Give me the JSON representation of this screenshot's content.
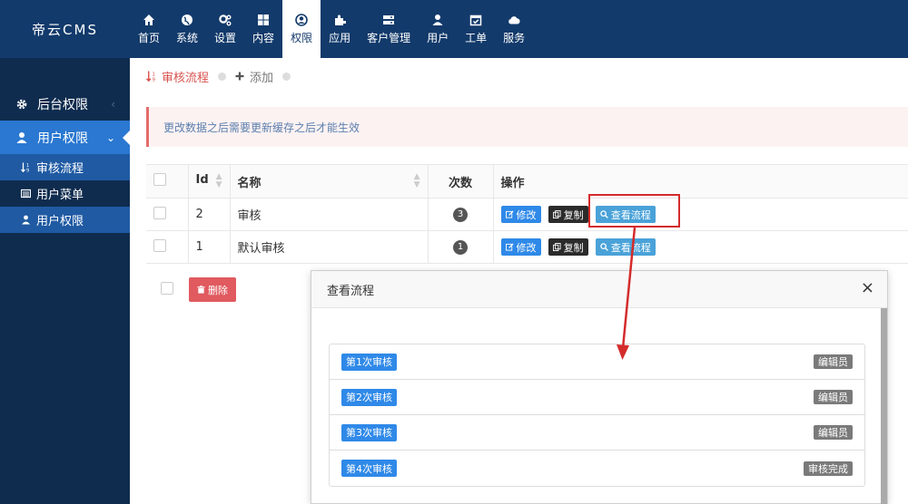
{
  "brand": "帝云CMS",
  "nav": [
    {
      "label": "首页",
      "icon": "home-icon"
    },
    {
      "label": "系统",
      "icon": "globe-icon"
    },
    {
      "label": "设置",
      "icon": "cogs-icon"
    },
    {
      "label": "内容",
      "icon": "grid-icon"
    },
    {
      "label": "权限",
      "icon": "user-circle-icon"
    },
    {
      "label": "应用",
      "icon": "puzzle-icon"
    },
    {
      "label": "客户管理",
      "icon": "server-icon"
    },
    {
      "label": "用户",
      "icon": "user-icon"
    },
    {
      "label": "工单",
      "icon": "calendar-check-icon"
    },
    {
      "label": "服务",
      "icon": "cloud-icon"
    }
  ],
  "sidebar": {
    "groups": [
      {
        "label": "后台权限",
        "icon": "gear-icon"
      },
      {
        "label": "用户权限",
        "icon": "user-icon"
      }
    ],
    "sub_items": [
      {
        "label": "审核流程",
        "icon": "sort-numeric-icon"
      },
      {
        "label": "用户菜单",
        "icon": "list-icon"
      },
      {
        "label": "用户权限",
        "icon": "user-icon"
      }
    ]
  },
  "breadcrumb": {
    "current": "审核流程",
    "add": "添加"
  },
  "alert": "更改数据之后需要更新缓存之后才能生效",
  "table": {
    "headers": {
      "id": "Id",
      "name": "名称",
      "count": "次数",
      "actions": "操作"
    },
    "rows": [
      {
        "id": "2",
        "name": "审核",
        "count": "3"
      },
      {
        "id": "1",
        "name": "默认审核",
        "count": "1"
      }
    ],
    "actions": {
      "edit": "修改",
      "copy": "复制",
      "view": "查看流程"
    }
  },
  "delete_label": "删除",
  "modal": {
    "title": "查看流程",
    "close": "×",
    "steps": [
      {
        "step": "第1次审核",
        "role": "编辑员"
      },
      {
        "step": "第2次审核",
        "role": "编辑员"
      },
      {
        "step": "第3次审核",
        "role": "编辑员"
      },
      {
        "step": "第4次审核",
        "role": "审核完成"
      }
    ]
  },
  "colors": {
    "topbar": "#123a6b",
    "sidebar": "#0f2c4f",
    "accent": "#2a78d1",
    "danger": "#e05a5f"
  }
}
